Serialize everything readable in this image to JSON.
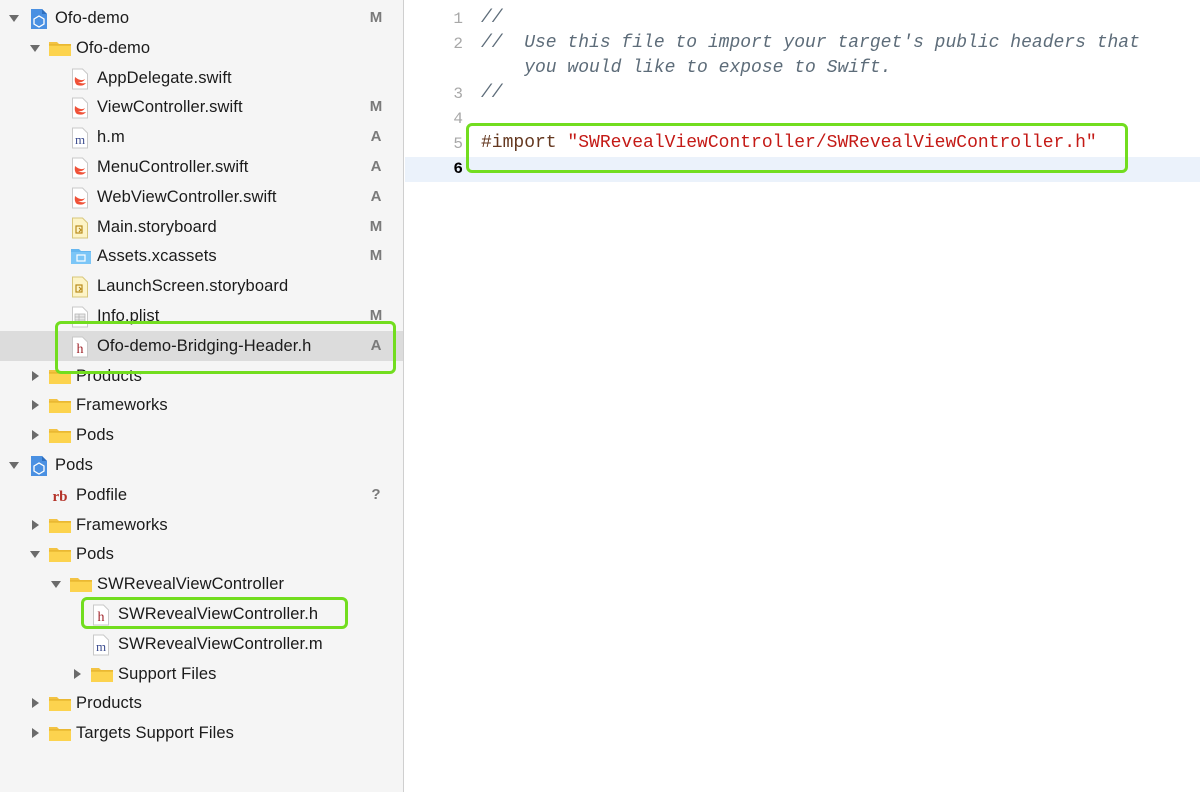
{
  "navigator": {
    "items": [
      {
        "label": "Ofo-demo",
        "badge": "M",
        "icon": "xcode-project-icon",
        "disclosure": "expanded"
      },
      {
        "label": "Ofo-demo",
        "badge": "",
        "icon": "folder-icon",
        "disclosure": "expanded"
      },
      {
        "label": "AppDelegate.swift",
        "badge": "",
        "icon": "swift-file-icon",
        "disclosure": "none"
      },
      {
        "label": "ViewController.swift",
        "badge": "M",
        "icon": "swift-file-icon",
        "disclosure": "none"
      },
      {
        "label": "h.m",
        "badge": "A",
        "icon": "objc-m-file-icon",
        "disclosure": "none"
      },
      {
        "label": "MenuController.swift",
        "badge": "A",
        "icon": "swift-file-icon",
        "disclosure": "none"
      },
      {
        "label": "WebViewController.swift",
        "badge": "A",
        "icon": "swift-file-icon",
        "disclosure": "none"
      },
      {
        "label": "Main.storyboard",
        "badge": "M",
        "icon": "storyboard-file-icon",
        "disclosure": "none"
      },
      {
        "label": "Assets.xcassets",
        "badge": "M",
        "icon": "asset-catalog-icon",
        "disclosure": "none"
      },
      {
        "label": "LaunchScreen.storyboard",
        "badge": "",
        "icon": "storyboard-file-icon",
        "disclosure": "none"
      },
      {
        "label": "Info.plist",
        "badge": "M",
        "icon": "plist-file-icon",
        "disclosure": "none"
      },
      {
        "label": "Ofo-demo-Bridging-Header.h",
        "badge": "A",
        "icon": "header-file-icon",
        "disclosure": "none",
        "selected": true
      },
      {
        "label": "Products",
        "badge": "",
        "icon": "folder-icon",
        "disclosure": "collapsed"
      },
      {
        "label": "Frameworks",
        "badge": "",
        "icon": "folder-icon",
        "disclosure": "collapsed"
      },
      {
        "label": "Pods",
        "badge": "",
        "icon": "folder-icon",
        "disclosure": "collapsed"
      },
      {
        "label": "Pods",
        "badge": "",
        "icon": "xcode-project-icon",
        "disclosure": "expanded"
      },
      {
        "label": "Podfile",
        "badge": "?",
        "icon": "ruby-file-icon",
        "disclosure": "none"
      },
      {
        "label": "Frameworks",
        "badge": "",
        "icon": "folder-icon",
        "disclosure": "collapsed"
      },
      {
        "label": "Pods",
        "badge": "",
        "icon": "folder-icon",
        "disclosure": "expanded"
      },
      {
        "label": "SWRevealViewController",
        "badge": "",
        "icon": "folder-icon",
        "disclosure": "expanded"
      },
      {
        "label": "SWRevealViewController.h",
        "badge": "",
        "icon": "header-file-icon",
        "disclosure": "none"
      },
      {
        "label": "SWRevealViewController.m",
        "badge": "",
        "icon": "objc-m-file-icon",
        "disclosure": "none"
      },
      {
        "label": "Support Files",
        "badge": "",
        "icon": "folder-icon",
        "disclosure": "collapsed"
      },
      {
        "label": "Products",
        "badge": "",
        "icon": "folder-icon",
        "disclosure": "collapsed"
      },
      {
        "label": "Targets Support Files",
        "badge": "",
        "icon": "folder-icon",
        "disclosure": "collapsed"
      }
    ]
  },
  "editor": {
    "current_line": 6,
    "lines": [
      {
        "number": "1",
        "segments": [
          {
            "text": "//",
            "kind": "comment"
          }
        ]
      },
      {
        "number": "2",
        "segments": [
          {
            "text": "//  Use this file to import your target's public headers that",
            "kind": "comment"
          }
        ]
      },
      {
        "number": "",
        "segments": [
          {
            "text": "    you would like to expose to Swift.",
            "kind": "comment"
          }
        ]
      },
      {
        "number": "3",
        "segments": [
          {
            "text": "//",
            "kind": "comment"
          }
        ]
      },
      {
        "number": "4",
        "segments": []
      },
      {
        "number": "5",
        "segments": [
          {
            "text": "#import ",
            "kind": "keyword"
          },
          {
            "text": "\"SWRevealViewController/SWRevealViewController.h\"",
            "kind": "string"
          }
        ]
      },
      {
        "number": "6",
        "segments": []
      }
    ]
  },
  "colors": {
    "highlight": "#72dd1f",
    "comment": "#5d6c79",
    "string": "#c41a16",
    "keyword": "#643820",
    "selection": "#dcdcdc"
  }
}
